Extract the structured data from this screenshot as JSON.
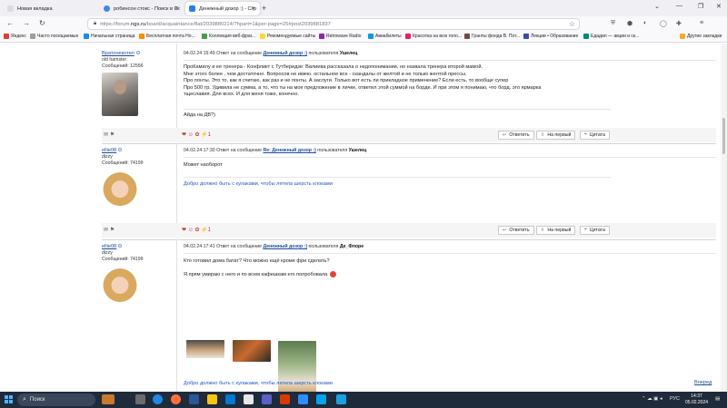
{
  "browser": {
    "tabs": [
      {
        "label": "Новая вкладка",
        "active": false,
        "color": "#e5e5e5"
      },
      {
        "label": "робинсон стокс - Поиск в Go...",
        "active": false,
        "color": "#4285f4"
      },
      {
        "label": "Денежный дозор :) - Страниц...",
        "active": true,
        "color": "#2b7de9"
      }
    ],
    "new_tab": "+",
    "url_prefix": "https://forum.",
    "url_domain": "ngs.ru",
    "url_rest": "/board/acquaintance/flat/2039880214/?hpart=1&per-page=25#post2039881837",
    "bookmarks": [
      "Яндекс",
      "Часто посещаемые",
      "Начальная страница",
      "Бесплатная почта Но...",
      "Коллекция веб-фраг...",
      "Рекомендуемые сайты",
      "Retrowave Radio",
      "Авиабилеты",
      "Красотка на всю голо...",
      "Гранты фонда В. Пот...",
      "Лекции • Образование",
      "Едадил — акции и ск...",
      "Другие закладки"
    ]
  },
  "posts": [
    {
      "user": {
        "name": "Вратонекотел",
        "title": "old hamster",
        "count": "Сообщений: 12556"
      },
      "body": [
        "ПроКамилу и ее тренера - Конфликт с Тутберидзе: Валиева рассказала о недопонимании, но назвала тренера второй мамой.",
        "Мне этого более , чем достаточно. Вопросов не имею. остальное все - скандалы от желтой и не только желтой прессы.",
        "Про понты. Это то, как я считаю, как раз и не понты. А заслуги. Только вот есть ли прикладное применение? Если есть, то вообще супер",
        "Про 500 тр. Удивила не сумма, а то, что ты на мое предложение в личке, ответил этой суммой на борде. И при этом я понимаю, что борд, это ярмарка",
        "тщеславия. Для всех. И для меня тоже, конечно."
      ],
      "signature": "Айда на ДВ?)"
    },
    {
      "head_date": "04.02.24 17:30",
      "head_reply": "Ответ на сообщение",
      "head_link": "Re: Денежный дозор :)",
      "head_user_label": "пользователя",
      "head_user": "Ушелец",
      "user": {
        "name": "ellie08",
        "title": "dizzy",
        "count": "Сообщений: 74199"
      },
      "body": [
        "Может наоборот"
      ],
      "signature": "Добро должно быть с кулаками, чтобы летела шерсть клоками"
    },
    {
      "head_date": "04.02.24 17:41",
      "head_reply": "Ответ на сообщение",
      "head_link": "Денежный дозор :)",
      "head_user_label": "пользователя",
      "head_user": "Де_Флоре",
      "user": {
        "name": "ellie08",
        "title": "dizzy",
        "count": "Сообщений: 74199"
      },
      "body": [
        "Кто готовил дома батат? Что можно ещё кроме фри сделать?",
        "Я прям умираю с него и по всем кафешкам его попробовала"
      ],
      "signature": "Добро должно быть с кулаками, чтобы летела шерсть клоками"
    }
  ],
  "first_head": {
    "date": "04.02.24 15:49",
    "reply": "Ответ на сообщение",
    "link": "Денежный дозор :)",
    "user_label": "пользователя",
    "user": "Ушелец"
  },
  "buttons": {
    "reply": "Ответить",
    "to_first": "На первый",
    "quote": "Цитата"
  },
  "next_link": "Вперед",
  "taskbar": {
    "search_placeholder": "Поиск",
    "lang": "РУС",
    "time": "14:37",
    "date": "05.02.2024"
  }
}
